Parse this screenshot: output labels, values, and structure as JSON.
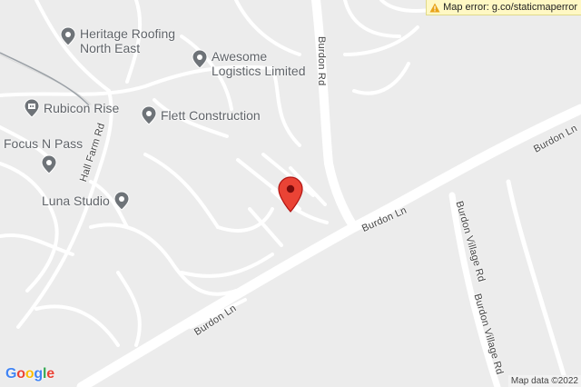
{
  "error_banner": {
    "icon": "warning-icon",
    "text": "Map error: g.co/staticmaperror"
  },
  "pois": [
    {
      "id": "heritage-roofing",
      "name": "Heritage Roofing\nNorth East",
      "icon": "pin-icon"
    },
    {
      "id": "awesome-logistics",
      "name": "Awesome\nLogistics Limited",
      "icon": "pin-icon"
    },
    {
      "id": "rubicon-rise",
      "name": "Rubicon Rise",
      "icon": "building-icon"
    },
    {
      "id": "flett-construction",
      "name": "Flett Construction",
      "icon": "pin-icon"
    },
    {
      "id": "focus-n-pass",
      "name": "Focus N Pass",
      "icon": "pin-icon"
    },
    {
      "id": "luna-studio",
      "name": "Luna Studio",
      "icon": "pin-icon"
    }
  ],
  "road_labels": {
    "burdon_rd": "Burdon Rd",
    "hall_farm_rd": "Hall Farm Rd",
    "burdon_ln_1": "Burdon Ln",
    "burdon_ln_2": "Burdon Ln",
    "burdon_ln_3": "Burdon Ln",
    "burdon_village_rd_1": "Burdon Village Rd",
    "burdon_village_rd_2": "Burdon Village Rd"
  },
  "logo": {
    "letters": [
      "G",
      "o",
      "o",
      "g",
      "l",
      "e"
    ],
    "colors": [
      "#4285F4",
      "#EA4335",
      "#FBBC05",
      "#4285F4",
      "#34A853",
      "#EA4335"
    ]
  },
  "attribution": "Map data ©2022",
  "marker": {
    "icon": "red-marker-icon",
    "color": "#EA4335"
  },
  "colors": {
    "background": "#ececec",
    "road": "#ffffff",
    "poi_text": "#5f6368",
    "poi_pin": "#6e7378"
  }
}
